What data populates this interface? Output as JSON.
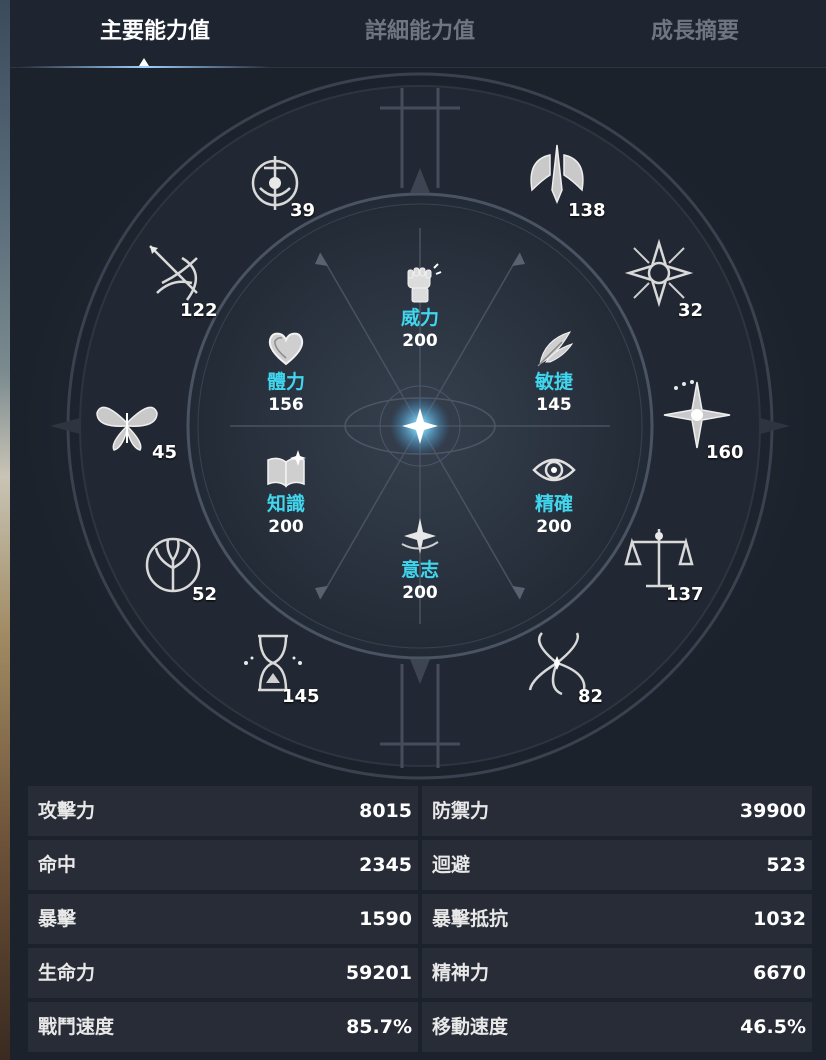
{
  "tabs": [
    {
      "label": "主要能力值",
      "active": true
    },
    {
      "label": "詳細能力值",
      "active": false
    },
    {
      "label": "成長摘要",
      "active": false
    }
  ],
  "outer_stats": [
    {
      "name": "sword-crest-icon",
      "value": "39"
    },
    {
      "name": "bow-wing-icon",
      "value": "122"
    },
    {
      "name": "butterfly-icon",
      "value": "45"
    },
    {
      "name": "tree-crest-icon",
      "value": "52"
    },
    {
      "name": "hourglass-icon",
      "value": "145"
    },
    {
      "name": "winged-blade-icon",
      "value": "138"
    },
    {
      "name": "star-burst-icon",
      "value": "32"
    },
    {
      "name": "compass-star-icon",
      "value": "160"
    },
    {
      "name": "scales-icon",
      "value": "137"
    },
    {
      "name": "swirl-star-icon",
      "value": "82"
    }
  ],
  "core_stats": [
    {
      "name": "威力",
      "value": "200",
      "icon": "fist-icon"
    },
    {
      "name": "體力",
      "value": "156",
      "icon": "heart-icon"
    },
    {
      "name": "敏捷",
      "value": "145",
      "icon": "feather-icon"
    },
    {
      "name": "知識",
      "value": "200",
      "icon": "book-icon"
    },
    {
      "name": "精確",
      "value": "200",
      "icon": "eye-icon"
    },
    {
      "name": "意志",
      "value": "200",
      "icon": "spark-icon"
    }
  ],
  "stats": [
    {
      "left": {
        "label": "攻擊力",
        "value": "8015"
      },
      "right": {
        "label": "防禦力",
        "value": "39900"
      }
    },
    {
      "left": {
        "label": "命中",
        "value": "2345"
      },
      "right": {
        "label": "迴避",
        "value": "523"
      }
    },
    {
      "left": {
        "label": "暴擊",
        "value": "1590"
      },
      "right": {
        "label": "暴擊抵抗",
        "value": "1032"
      }
    },
    {
      "left": {
        "label": "生命力",
        "value": "59201"
      },
      "right": {
        "label": "精神力",
        "value": "6670"
      }
    },
    {
      "left": {
        "label": "戰鬥速度",
        "value": "85.7%"
      },
      "right": {
        "label": "移動速度",
        "value": "46.5%"
      }
    }
  ],
  "colors": {
    "accent": "#41d6ee",
    "panel": "#1c222c",
    "cell": "#272c36"
  }
}
